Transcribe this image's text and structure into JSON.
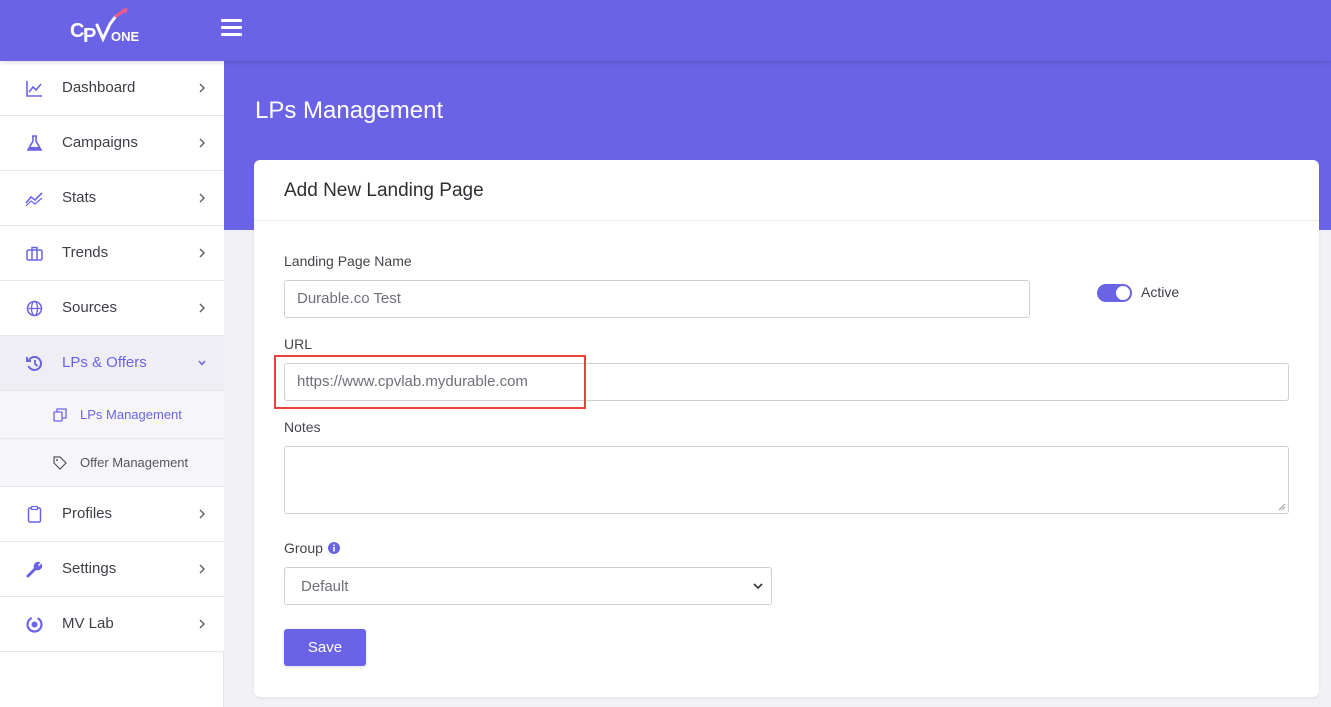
{
  "app": {
    "logo_text": "CPV ONE"
  },
  "sidebar": {
    "items": [
      {
        "label": "Dashboard",
        "icon": "chart-line-icon"
      },
      {
        "label": "Campaigns",
        "icon": "flask-icon"
      },
      {
        "label": "Stats",
        "icon": "stats-icon"
      },
      {
        "label": "Trends",
        "icon": "briefcase-icon"
      },
      {
        "label": "Sources",
        "icon": "globe-icon"
      },
      {
        "label": "LPs & Offers",
        "icon": "history-icon",
        "expanded": true
      },
      {
        "label": "Profiles",
        "icon": "clipboard-icon"
      },
      {
        "label": "Settings",
        "icon": "wrench-icon"
      },
      {
        "label": "MV Lab",
        "icon": "mvlab-icon"
      }
    ],
    "subitems": [
      {
        "label": "LPs Management",
        "icon": "copy-icon",
        "active": true
      },
      {
        "label": "Offer Management",
        "icon": "tag-icon"
      }
    ]
  },
  "page": {
    "title": "LPs Management"
  },
  "form": {
    "card_title": "Add New Landing Page",
    "name_label": "Landing Page Name",
    "name_value": "Durable.co Test",
    "active_label": "Active",
    "active": true,
    "url_label": "URL",
    "url_value": "https://www.cpvlab.mydurable.com",
    "notes_label": "Notes",
    "notes_value": "",
    "group_label": "Group",
    "group_value": "Default",
    "save_label": "Save"
  },
  "colors": {
    "accent": "#6b63e6",
    "highlight": "#e8413e"
  }
}
